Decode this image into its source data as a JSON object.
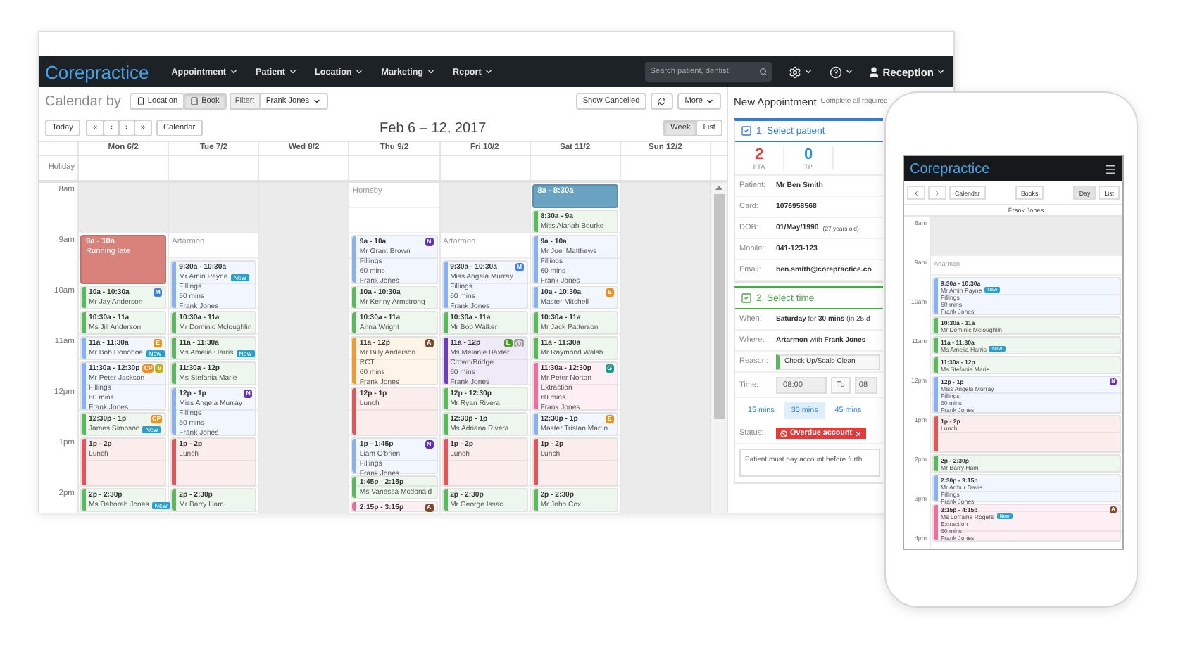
{
  "nav": {
    "logo": "Corepractice",
    "menu": [
      "Appointment",
      "Patient",
      "Location",
      "Marketing",
      "Report"
    ],
    "search": {
      "placeholder": "Search patient, dentist"
    },
    "user": "Reception"
  },
  "toolbar": {
    "label": "Calendar by",
    "views": [
      {
        "label": "Location",
        "selected": false
      },
      {
        "label": "Book",
        "selected": true
      }
    ],
    "filter_label": "Filter:",
    "filter_value": "Frank Jones",
    "show_cancelled": "Show Cancelled",
    "more": "More"
  },
  "date_nav": {
    "today": "Today",
    "buttons": [
      "«",
      "‹",
      "›",
      "»"
    ],
    "calendar": "Calendar",
    "title": "Feb 6 – 12, 2017",
    "modes": [
      {
        "label": "Week",
        "selected": true
      },
      {
        "label": "List",
        "selected": false
      }
    ]
  },
  "holiday_label": "Holiday",
  "times": [
    "8am",
    "9am",
    "10am",
    "11am",
    "12pm",
    "1pm",
    "2pm"
  ],
  "columns": [
    {
      "day": "Mon 6/2",
      "slots": [
        {
          "kind": "unavailable"
        },
        {
          "kind": "block",
          "color": "#d9827b",
          "time": "9a - 10a",
          "name": "Running late"
        },
        {
          "kind": "event",
          "color": "#5cb85c",
          "time": "10a - 10:30a",
          "name": "Mr Jay Anderson",
          "badges": [
            {
              "kind": "letter",
              "label": "M",
              "color": "#3d7fe3"
            }
          ]
        },
        {
          "kind": "event",
          "color": "#5cb85c",
          "time": "10:30a - 11a",
          "name": "Ms Jill Anderson"
        },
        {
          "kind": "event",
          "color": "#8ab0f2",
          "time": "11a - 11:30a",
          "name": "Mr Bob Donohoe",
          "tag": "New",
          "badges": [
            {
              "kind": "letter",
              "label": "E",
              "color": "#f0901e"
            }
          ]
        },
        {
          "kind": "long-event",
          "color": "#8ab0f2",
          "time": "11:30a - 12:30p",
          "name": "Mr Peter Jackson",
          "details": [
            "Fillings",
            "60 mins",
            "Frank Jones"
          ],
          "badges": [
            {
              "kind": "letter",
              "label": "CP",
              "color": "#f0901e"
            },
            {
              "kind": "letter",
              "label": "V",
              "color": "#c2b01c"
            }
          ]
        },
        {
          "kind": "event",
          "color": "#5cb85c",
          "time": "12:30p - 1p",
          "name": "James Simpson",
          "tag": "New",
          "badges": [
            {
              "kind": "letter",
              "label": "CP",
              "color": "#f0901e"
            }
          ]
        },
        {
          "kind": "long-event",
          "color": "#e0575b",
          "time": "1p - 2p",
          "name": "Lunch"
        },
        {
          "kind": "event",
          "color": "#5cb85c",
          "time": "2p - 2:30p",
          "name": "Ms Deborah Jones",
          "tag": "New"
        }
      ]
    },
    {
      "day": "Tue 7/2",
      "slots": [
        {
          "kind": "unavailable"
        },
        {
          "kind": "label",
          "text": "Artarmon"
        },
        {
          "kind": "long-event",
          "color": "#8ab0f2",
          "time": "9:30a - 10:30a",
          "name": "Mr Amin Payne",
          "tag": "New",
          "details": [
            "Fillings",
            "60 mins",
            "Frank Jones"
          ]
        },
        {
          "kind": "event",
          "color": "#5cb85c",
          "time": "10:30a - 11a",
          "name": "Mr Dominic Mcloughlin"
        },
        {
          "kind": "event",
          "color": "#5cb85c",
          "time": "11a - 11:30a",
          "name": "Ms Amelia Harris",
          "tag": "New"
        },
        {
          "kind": "event",
          "color": "#5cb85c",
          "time": "11:30a - 12p",
          "name": "Ms Stefania Marie"
        },
        {
          "kind": "long-event",
          "color": "#8ab0f2",
          "time": "12p - 1p",
          "name": "Miss Angela Murray",
          "details": [
            "Fillings",
            "60 mins",
            "Frank Jones"
          ],
          "badges": [
            {
              "kind": "letter",
              "label": "N",
              "color": "#6233b5"
            }
          ]
        },
        {
          "kind": "long-event",
          "color": "#e0575b",
          "time": "1p - 2p",
          "name": "Lunch"
        },
        {
          "kind": "event",
          "color": "#5cb85c",
          "time": "2p - 2:30p",
          "name": "Mr Barry Ham"
        }
      ]
    },
    {
      "day": "Wed 8/2",
      "slots": [
        {
          "kind": "closed"
        }
      ]
    },
    {
      "day": "Thu 9/2",
      "slots": [
        {
          "kind": "long-label",
          "text": "Hornsby"
        },
        {
          "kind": "long-event",
          "color": "#8ab0f2",
          "time": "9a - 10a",
          "name": "Mr Grant Brown",
          "details": [
            "Fillings",
            "60 mins",
            "Frank Jones"
          ],
          "badges": [
            {
              "kind": "letter",
              "label": "N",
              "color": "#6233b5"
            }
          ]
        },
        {
          "kind": "event",
          "color": "#5cb85c",
          "time": "10a - 10:30a",
          "name": "Mr Kenny Armstrong"
        },
        {
          "kind": "event",
          "color": "#5cb85c",
          "time": "10:30a - 11a",
          "name": "Anna Wright"
        },
        {
          "kind": "long-event",
          "color": "#f39a2e",
          "time": "11a - 12p",
          "name": "Mr Billy Anderson",
          "details": [
            "RCT",
            "60 mins",
            "Frank Jones"
          ],
          "badges": [
            {
              "kind": "letter",
              "label": "A",
              "color": "#7a4a2e"
            }
          ]
        },
        {
          "kind": "long-event",
          "color": "#e0575b",
          "time": "12p - 1p",
          "name": "Lunch"
        },
        {
          "kind": "medium-event",
          "color": "#8ab0f2",
          "time": "1p - 1:45p",
          "name": "Liam O'brien",
          "details": [
            "Fillings",
            "Frank Jones"
          ],
          "badges": [
            {
              "kind": "letter",
              "label": "N",
              "color": "#6233b5"
            }
          ]
        },
        {
          "kind": "event",
          "color": "#5cb85c",
          "time": "1:45p - 2:15p",
          "name": "Ms Vanessa Mcdonald"
        },
        {
          "kind": "brief-event",
          "color": "#f06c9b",
          "time": "2:15p - 3:15p",
          "badges": [
            {
              "kind": "letter",
              "label": "A",
              "color": "#7a4a2e"
            }
          ]
        }
      ]
    },
    {
      "day": "Fri 10/2",
      "slots": [
        {
          "kind": "unavailable"
        },
        {
          "kind": "label",
          "text": "Artarmon"
        },
        {
          "kind": "long-event",
          "color": "#8ab0f2",
          "time": "9:30a - 10:30a",
          "name": "Miss Angela Murray",
          "details": [
            "Fillings",
            "60 mins",
            "Frank Jones"
          ],
          "badges": [
            {
              "kind": "letter",
              "label": "M",
              "color": "#3d7fe3"
            }
          ]
        },
        {
          "kind": "event",
          "color": "#5cb85c",
          "time": "10:30a - 11a",
          "name": "Mr Bob Walker"
        },
        {
          "kind": "long-event",
          "color": "#6b3fb8",
          "time": "11a - 12p",
          "name": "Ms Melanie Baxter",
          "details": [
            "Crown/Bridge",
            "60 mins",
            "Frank Jones"
          ],
          "badges": [
            {
              "kind": "letter",
              "label": "L",
              "color": "#4f9a2f"
            },
            {
              "kind": "icon",
              "color": "#9a9a9a"
            }
          ]
        },
        {
          "kind": "event",
          "color": "#5cb85c",
          "time": "12p - 12:30p",
          "name": "Mr Ryan Rivera"
        },
        {
          "kind": "event",
          "color": "#5cb85c",
          "time": "12:30p - 1p",
          "name": "Ms Adriana Rivera"
        },
        {
          "kind": "long-event",
          "color": "#e0575b",
          "time": "1p - 2p",
          "name": "Lunch"
        },
        {
          "kind": "event",
          "color": "#5cb85c",
          "time": "2p - 2:30p",
          "name": "Mr George Issac"
        }
      ]
    },
    {
      "day": "Sat 11/2",
      "slots": [
        {
          "kind": "short-block",
          "color": "#6aa3c2",
          "time": "8a - 8:30a"
        },
        {
          "kind": "event",
          "color": "#5cb85c",
          "time": "8:30a - 9a",
          "name": "Miss Alanah Bourke"
        },
        {
          "kind": "long-event",
          "color": "#8ab0f2",
          "time": "9a - 10a",
          "name": "Mr Joel Matthews",
          "details": [
            "Fillings",
            "60 mins",
            "Frank Jones"
          ]
        },
        {
          "kind": "event",
          "color": "#8ab0f2",
          "time": "10a - 10:30a",
          "name": "Master Mitchell",
          "badges": [
            {
              "kind": "letter",
              "label": "E",
              "color": "#f0901e"
            }
          ]
        },
        {
          "kind": "event",
          "color": "#5cb85c",
          "time": "10:30a - 11a",
          "name": "Mr Jack Patterson"
        },
        {
          "kind": "event",
          "color": "#5cb85c",
          "time": "11a - 11:30a",
          "name": "Mr Raymond Walsh"
        },
        {
          "kind": "long-event",
          "color": "#f06c9b",
          "time": "11:30a - 12:30p",
          "name": "Mr Peter Norton",
          "details": [
            "Extraction",
            "60 mins",
            "Frank Jones"
          ],
          "badges": [
            {
              "kind": "letter",
              "label": "G",
              "color": "#1e9a8a"
            }
          ]
        },
        {
          "kind": "event",
          "color": "#8ab0f2",
          "time": "12:30p - 1p",
          "name": "Master Tristan Martin",
          "badges": [
            {
              "kind": "letter",
              "label": "E",
              "color": "#f0901e"
            }
          ]
        },
        {
          "kind": "long-event",
          "color": "#e0575b",
          "time": "1p - 2p",
          "name": "Lunch"
        },
        {
          "kind": "event",
          "color": "#5cb85c",
          "time": "2p - 2:30p",
          "name": "Mr John Cox"
        }
      ]
    },
    {
      "day": "Sun 12/2",
      "slots": [
        {
          "kind": "closed"
        }
      ]
    }
  ],
  "appointment": {
    "title": "New Appointment",
    "subtitle": "Complete all required",
    "patient_section": {
      "title": "1. Select patient",
      "checked": true,
      "stats": [
        {
          "value": "2",
          "label": "FTA",
          "color": "#e23b3b"
        },
        {
          "value": "0",
          "label": "TP",
          "color": "#2f8fe0"
        }
      ],
      "fields": [
        {
          "label": "Patient:",
          "value": "Mr Ben Smith"
        },
        {
          "label": "Card:",
          "value": "1076958568"
        },
        {
          "label": "DOB:",
          "value": "01/May/1990",
          "note": "(27 years old)"
        },
        {
          "label": "Mobile:",
          "value": "041-123-123"
        },
        {
          "label": "Email:",
          "value": "ben.smith@corepractice.co"
        }
      ]
    },
    "time_section": {
      "title": "2. Select time",
      "checked": true,
      "when": {
        "label": "When:",
        "value": "**Saturday** for **30 mins** (in 25 d"
      },
      "where": {
        "label": "Where:",
        "value": "**Artarmon** with **Frank Jones**"
      },
      "reason": {
        "label": "Reason:",
        "value": "Check Up/Scale Clean"
      },
      "time": {
        "label": "Time:",
        "from": "08:00",
        "to_label": "To",
        "to": "08"
      },
      "durations": [
        {
          "label": "15 mins",
          "selected": false
        },
        {
          "label": "30 mins",
          "selected": true
        },
        {
          "label": "45 mins",
          "selected": false
        }
      ],
      "status": {
        "label": "Status:",
        "tag": "Overdue account"
      },
      "note": "Patient must pay account before furth"
    }
  },
  "phone": {
    "logo": "Corepractice",
    "calendar": "Calendar",
    "books": "Books",
    "modes": [
      {
        "label": "Day",
        "selected": true
      },
      {
        "label": "List",
        "selected": false
      }
    ],
    "column": "Frank Jones",
    "times": [
      "8am",
      "9am",
      "10am",
      "11am",
      "12pm",
      "1pm",
      "2pm",
      "3pm",
      "4pm"
    ],
    "slots": [
      {
        "kind": "unavailable"
      },
      {
        "kind": "label",
        "text": "Artarmon"
      },
      {
        "kind": "long-event",
        "color": "#8ab0f2",
        "time": "9:30a - 10:30a",
        "name": "Mr Amin Payne",
        "tag": "New",
        "details": [
          "Fillings",
          "60 mins",
          "Frank Jones"
        ]
      },
      {
        "kind": "event",
        "color": "#5cb85c",
        "time": "10:30a - 11a",
        "name": "Mr Dominic Mcloughlin"
      },
      {
        "kind": "event",
        "color": "#5cb85c",
        "time": "11a - 11:30a",
        "name": "Ms Amelia Harris",
        "tag": "New"
      },
      {
        "kind": "event",
        "color": "#5cb85c",
        "time": "11:30a - 12p",
        "name": "Ms Stefania Marie"
      },
      {
        "kind": "long-event",
        "color": "#8ab0f2",
        "time": "12p - 1p",
        "name": "Miss Angela Murray",
        "details": [
          "Fillings",
          "60 mins",
          "Frank Jones"
        ],
        "badges": [
          {
            "kind": "letter",
            "label": "N",
            "color": "#6233b5"
          }
        ]
      },
      {
        "kind": "long-event",
        "color": "#e0575b",
        "time": "1p - 2p",
        "name": "Lunch"
      },
      {
        "kind": "event",
        "color": "#5cb85c",
        "time": "2p - 2:30p",
        "name": "Mr Barry Ham"
      },
      {
        "kind": "medium-event",
        "color": "#8ab0f2",
        "time": "2:30p - 3:15p",
        "name": "Mr Arthur Davis",
        "details": [
          "Fillings",
          "Frank Jones"
        ]
      },
      {
        "kind": "long-event",
        "color": "#f06c9b",
        "time": "3:15p - 4:15p",
        "name": "Ms Lorraine Rogers",
        "tag": "New",
        "details": [
          "Extraction",
          "60 mins",
          "Frank Jones"
        ],
        "badges": [
          {
            "kind": "letter",
            "label": "A",
            "color": "#7a4a2e"
          }
        ]
      }
    ]
  }
}
